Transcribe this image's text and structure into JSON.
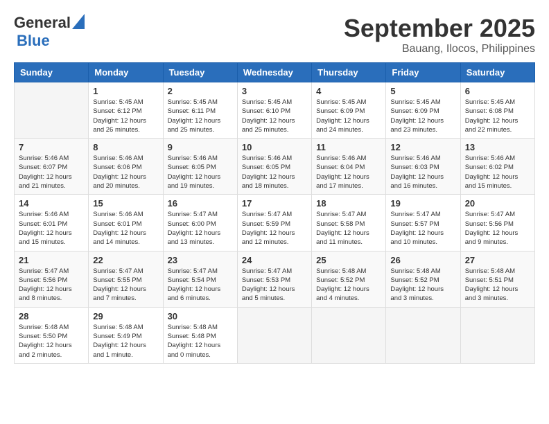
{
  "header": {
    "logo_general": "General",
    "logo_blue": "Blue",
    "month_title": "September 2025",
    "location": "Bauang, Ilocos, Philippines"
  },
  "calendar": {
    "days_of_week": [
      "Sunday",
      "Monday",
      "Tuesday",
      "Wednesday",
      "Thursday",
      "Friday",
      "Saturday"
    ],
    "weeks": [
      [
        {
          "day": "",
          "info": ""
        },
        {
          "day": "1",
          "info": "Sunrise: 5:45 AM\nSunset: 6:12 PM\nDaylight: 12 hours\nand 26 minutes."
        },
        {
          "day": "2",
          "info": "Sunrise: 5:45 AM\nSunset: 6:11 PM\nDaylight: 12 hours\nand 25 minutes."
        },
        {
          "day": "3",
          "info": "Sunrise: 5:45 AM\nSunset: 6:10 PM\nDaylight: 12 hours\nand 25 minutes."
        },
        {
          "day": "4",
          "info": "Sunrise: 5:45 AM\nSunset: 6:09 PM\nDaylight: 12 hours\nand 24 minutes."
        },
        {
          "day": "5",
          "info": "Sunrise: 5:45 AM\nSunset: 6:09 PM\nDaylight: 12 hours\nand 23 minutes."
        },
        {
          "day": "6",
          "info": "Sunrise: 5:45 AM\nSunset: 6:08 PM\nDaylight: 12 hours\nand 22 minutes."
        }
      ],
      [
        {
          "day": "7",
          "info": "Sunrise: 5:46 AM\nSunset: 6:07 PM\nDaylight: 12 hours\nand 21 minutes."
        },
        {
          "day": "8",
          "info": "Sunrise: 5:46 AM\nSunset: 6:06 PM\nDaylight: 12 hours\nand 20 minutes."
        },
        {
          "day": "9",
          "info": "Sunrise: 5:46 AM\nSunset: 6:05 PM\nDaylight: 12 hours\nand 19 minutes."
        },
        {
          "day": "10",
          "info": "Sunrise: 5:46 AM\nSunset: 6:05 PM\nDaylight: 12 hours\nand 18 minutes."
        },
        {
          "day": "11",
          "info": "Sunrise: 5:46 AM\nSunset: 6:04 PM\nDaylight: 12 hours\nand 17 minutes."
        },
        {
          "day": "12",
          "info": "Sunrise: 5:46 AM\nSunset: 6:03 PM\nDaylight: 12 hours\nand 16 minutes."
        },
        {
          "day": "13",
          "info": "Sunrise: 5:46 AM\nSunset: 6:02 PM\nDaylight: 12 hours\nand 15 minutes."
        }
      ],
      [
        {
          "day": "14",
          "info": "Sunrise: 5:46 AM\nSunset: 6:01 PM\nDaylight: 12 hours\nand 15 minutes."
        },
        {
          "day": "15",
          "info": "Sunrise: 5:46 AM\nSunset: 6:01 PM\nDaylight: 12 hours\nand 14 minutes."
        },
        {
          "day": "16",
          "info": "Sunrise: 5:47 AM\nSunset: 6:00 PM\nDaylight: 12 hours\nand 13 minutes."
        },
        {
          "day": "17",
          "info": "Sunrise: 5:47 AM\nSunset: 5:59 PM\nDaylight: 12 hours\nand 12 minutes."
        },
        {
          "day": "18",
          "info": "Sunrise: 5:47 AM\nSunset: 5:58 PM\nDaylight: 12 hours\nand 11 minutes."
        },
        {
          "day": "19",
          "info": "Sunrise: 5:47 AM\nSunset: 5:57 PM\nDaylight: 12 hours\nand 10 minutes."
        },
        {
          "day": "20",
          "info": "Sunrise: 5:47 AM\nSunset: 5:56 PM\nDaylight: 12 hours\nand 9 minutes."
        }
      ],
      [
        {
          "day": "21",
          "info": "Sunrise: 5:47 AM\nSunset: 5:56 PM\nDaylight: 12 hours\nand 8 minutes."
        },
        {
          "day": "22",
          "info": "Sunrise: 5:47 AM\nSunset: 5:55 PM\nDaylight: 12 hours\nand 7 minutes."
        },
        {
          "day": "23",
          "info": "Sunrise: 5:47 AM\nSunset: 5:54 PM\nDaylight: 12 hours\nand 6 minutes."
        },
        {
          "day": "24",
          "info": "Sunrise: 5:47 AM\nSunset: 5:53 PM\nDaylight: 12 hours\nand 5 minutes."
        },
        {
          "day": "25",
          "info": "Sunrise: 5:48 AM\nSunset: 5:52 PM\nDaylight: 12 hours\nand 4 minutes."
        },
        {
          "day": "26",
          "info": "Sunrise: 5:48 AM\nSunset: 5:52 PM\nDaylight: 12 hours\nand 3 minutes."
        },
        {
          "day": "27",
          "info": "Sunrise: 5:48 AM\nSunset: 5:51 PM\nDaylight: 12 hours\nand 3 minutes."
        }
      ],
      [
        {
          "day": "28",
          "info": "Sunrise: 5:48 AM\nSunset: 5:50 PM\nDaylight: 12 hours\nand 2 minutes."
        },
        {
          "day": "29",
          "info": "Sunrise: 5:48 AM\nSunset: 5:49 PM\nDaylight: 12 hours\nand 1 minute."
        },
        {
          "day": "30",
          "info": "Sunrise: 5:48 AM\nSunset: 5:48 PM\nDaylight: 12 hours\nand 0 minutes."
        },
        {
          "day": "",
          "info": ""
        },
        {
          "day": "",
          "info": ""
        },
        {
          "day": "",
          "info": ""
        },
        {
          "day": "",
          "info": ""
        }
      ]
    ]
  }
}
